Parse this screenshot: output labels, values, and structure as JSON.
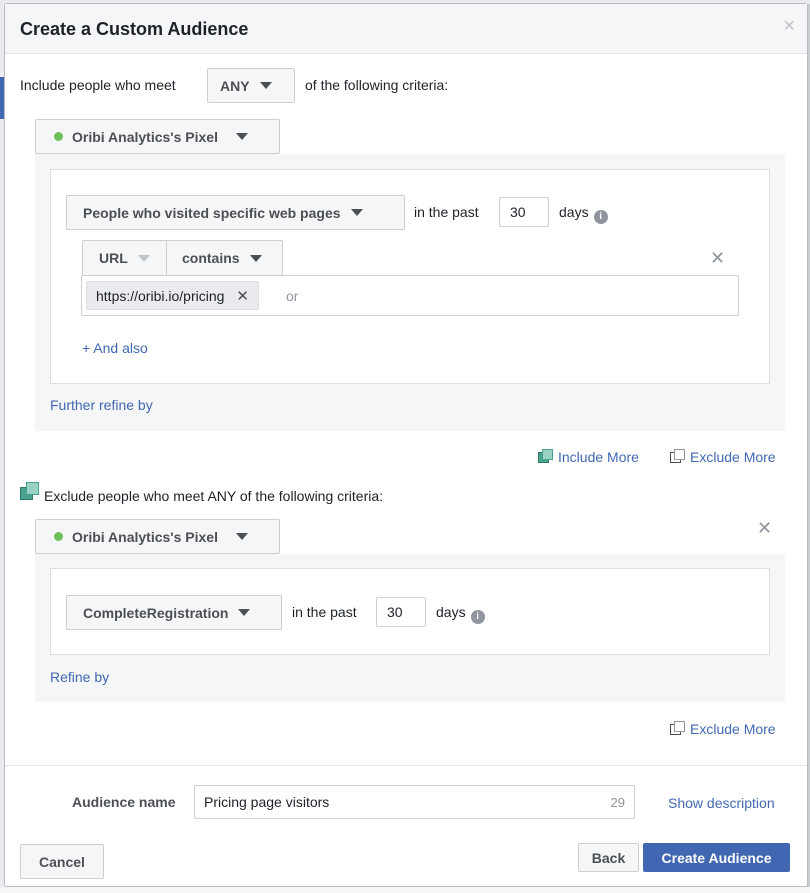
{
  "dialog": {
    "title": "Create a Custom Audience",
    "close_glyph": "×"
  },
  "include": {
    "prefix": "Include people who meet",
    "match_value": "ANY",
    "suffix": "of the following criteria:",
    "source_label": "Oribi Analytics's Pixel",
    "rule_label": "People who visited specific web pages",
    "in_the_past": "in the past",
    "days_value": "30",
    "days_label": "days",
    "url_field": "URL",
    "operator": "contains",
    "url_tag": "https://oribi.io/pricing",
    "tag_remove": "✕",
    "input_placeholder": "or",
    "remove_glyph": "✕",
    "and_also": "+ And also",
    "further_refine": "Further refine by"
  },
  "actions": {
    "include_more": "Include More",
    "exclude_more": "Exclude More",
    "exclude_more_2": "Exclude More"
  },
  "exclude": {
    "label": "Exclude people who meet ANY of the following criteria:",
    "source_label": "Oribi Analytics's Pixel",
    "remove_glyph": "✕",
    "event_label": "CompleteRegistration",
    "in_the_past": "in the past",
    "days_value": "30",
    "days_label": "days",
    "refine_by": "Refine by"
  },
  "footer": {
    "audience_name_label": "Audience name",
    "audience_name_value": "Pricing page visitors",
    "char_count": "29",
    "show_description": "Show description",
    "cancel": "Cancel",
    "back": "Back",
    "create": "Create Audience"
  },
  "icons": {
    "info": "i"
  },
  "colors": {
    "accent": "#4267b2",
    "status_dot": "#6fbf5a",
    "panel_bg": "#f5f6f7"
  }
}
